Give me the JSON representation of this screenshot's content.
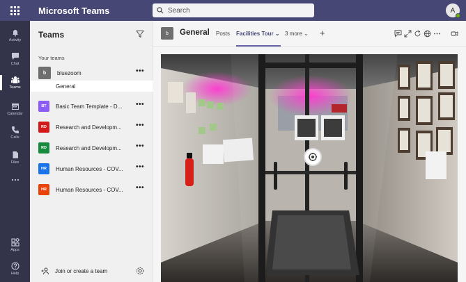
{
  "app": {
    "title": "Microsoft Teams"
  },
  "search": {
    "placeholder": "Search"
  },
  "user": {
    "initial": "A",
    "presence_color": "#6bb700"
  },
  "rail": {
    "items": [
      {
        "label": "Activity",
        "icon": "bell-icon"
      },
      {
        "label": "Chat",
        "icon": "chat-icon"
      },
      {
        "label": "Teams",
        "icon": "teams-icon"
      },
      {
        "label": "Calendar",
        "icon": "calendar-icon"
      },
      {
        "label": "Calls",
        "icon": "phone-icon"
      },
      {
        "label": "Files",
        "icon": "file-icon"
      },
      {
        "label": "",
        "icon": "more-icon"
      }
    ],
    "bottom": [
      {
        "label": "Apps",
        "icon": "apps-icon"
      },
      {
        "label": "Help",
        "icon": "help-icon"
      }
    ]
  },
  "teams_panel": {
    "title": "Teams",
    "section_label": "Your teams",
    "teams": [
      {
        "initials": "b",
        "name": "bluezoom",
        "color": "#6e6e6e"
      },
      {
        "initials": "BT",
        "name": "Basic Team Template - D...",
        "color": "#8b5cf6"
      },
      {
        "initials": "RD",
        "name": "Research and Developm...",
        "color": "#d31a1a"
      },
      {
        "initials": "RD",
        "name": "Research and Developm...",
        "color": "#178a3e"
      },
      {
        "initials": "HR",
        "name": "Human Resources - COV...",
        "color": "#1a73e8"
      },
      {
        "initials": "HR",
        "name": "Human Resources - COV...",
        "color": "#e8430a"
      }
    ],
    "selected_channel": "General",
    "more_label": "•••",
    "join_label": "Join or create a team"
  },
  "channel": {
    "initial": "b",
    "name": "General",
    "tabs": [
      {
        "label": "Posts",
        "active": false
      },
      {
        "label": "Facilities Tour ⌄",
        "active": true
      },
      {
        "label": "3 more ⌄",
        "active": false
      },
      {
        "label": "+",
        "active": false
      }
    ]
  },
  "accent": "#6264a7",
  "header_color": "#464775"
}
